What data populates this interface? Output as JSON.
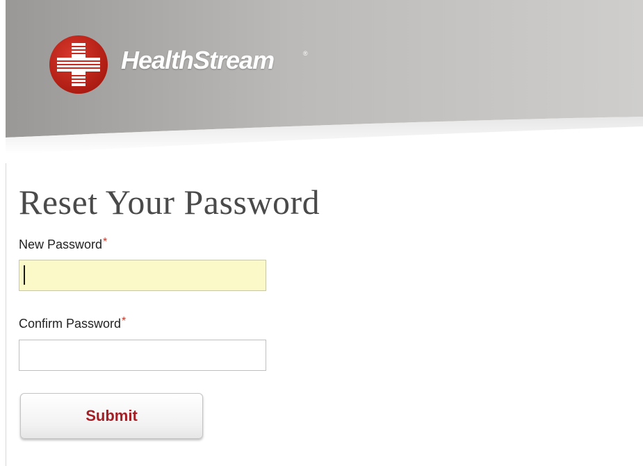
{
  "header": {
    "brand_name": "HealthStream",
    "brand_registered_mark": "®",
    "logo_icon": "healthstream-cross-globe-icon",
    "brand_color": "#c8281e"
  },
  "form": {
    "title": "Reset Your Password",
    "new_password": {
      "label": "New Password",
      "required_marker": "*",
      "value": "",
      "placeholder": "",
      "focused": true,
      "background_color": "#fbf9c8"
    },
    "confirm_password": {
      "label": "Confirm Password",
      "required_marker": "*",
      "value": "",
      "placeholder": ""
    },
    "submit_label": "Submit",
    "submit_text_color": "#a31f25"
  }
}
